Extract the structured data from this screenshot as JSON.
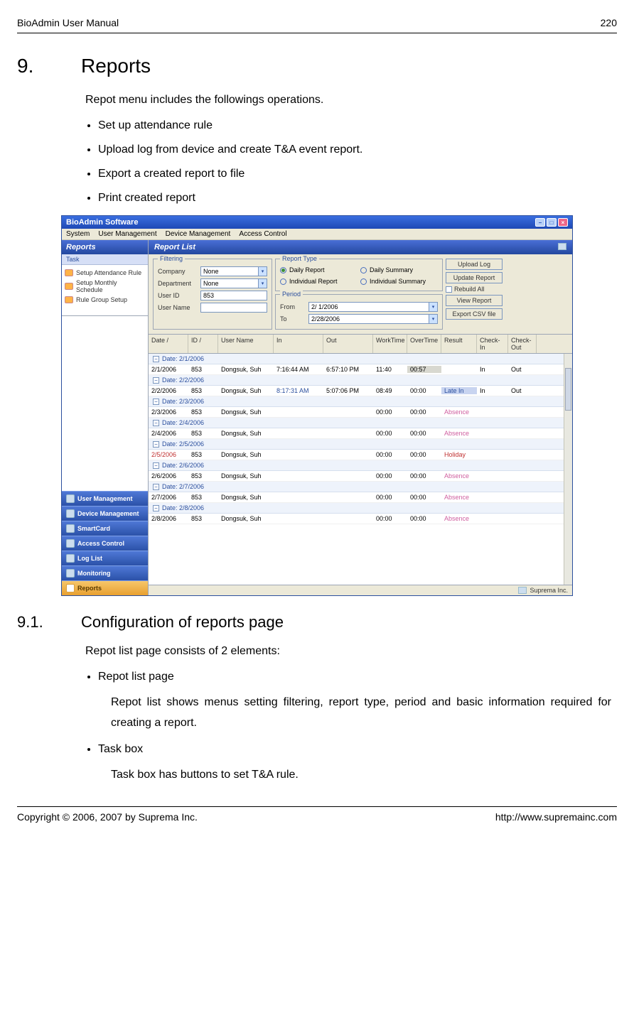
{
  "header": {
    "left": "BioAdmin User Manual",
    "right": "220"
  },
  "section": {
    "num": "9.",
    "title": "Reports"
  },
  "intro": "Repot menu includes the followings operations.",
  "bullets1": [
    "Set up attendance rule",
    "Upload log from device and create T&A event report.",
    "Export a created report to file",
    "Print created report"
  ],
  "subsection": {
    "num": "9.1.",
    "title": "Configuration of reports page"
  },
  "intro2": "Repot list page consists of 2 elements:",
  "items2": [
    {
      "title": "Repot list page",
      "desc": "Repot list shows menus setting filtering, report type, period and basic information required for creating a report."
    },
    {
      "title": "Task box",
      "desc": "Task box has buttons to set T&A rule."
    }
  ],
  "footer": {
    "left": "Copyright © 2006, 2007 by Suprema Inc.",
    "right": "http://www.supremainc.com"
  },
  "app": {
    "title": "BioAdmin Software",
    "menus": [
      "System",
      "User Management",
      "Device Management",
      "Access Control"
    ],
    "leftHeader": "Reports",
    "taskHeader": "Task",
    "tasks": [
      "Setup Attendance Rule",
      "Setup Monthly Schedule",
      "Rule Group Setup"
    ],
    "nav": [
      "User Management",
      "Device Management",
      "SmartCard",
      "Access Control",
      "Log List",
      "Monitoring",
      "Reports"
    ],
    "navActive": "Reports",
    "rightHeader": "Report List",
    "filtering": {
      "legend": "Filtering",
      "company": {
        "label": "Company",
        "value": "None"
      },
      "department": {
        "label": "Department",
        "value": "None"
      },
      "userId": {
        "label": "User ID",
        "value": "853"
      },
      "userName": {
        "label": "User Name",
        "value": ""
      }
    },
    "reportType": {
      "legend": "Report Type",
      "options": [
        "Daily Report",
        "Daily Summary",
        "Individual Report",
        "Individual Summary"
      ],
      "selected": "Daily Report"
    },
    "period": {
      "legend": "Period",
      "from": {
        "label": "From",
        "value": "2/ 1/2006"
      },
      "to": {
        "label": "To",
        "value": "2/28/2006"
      }
    },
    "buttons": {
      "upload": "Upload Log",
      "update": "Update Report",
      "rebuild": "Rebuild All",
      "view": "View Report",
      "export": "Export CSV file"
    },
    "columns": [
      "Date   /",
      "ID   /",
      "User Name",
      "In",
      "Out",
      "WorkTime",
      "OverTime",
      "Result",
      "Check-In",
      "Check-Out"
    ],
    "groups": [
      {
        "label": "Date: 2/1/2006",
        "rows": [
          {
            "date": "2/1/2006",
            "id": "853",
            "name": "Dongsuk, Suh",
            "in": "7:16:44 AM",
            "out": "6:57:10 PM",
            "wt": "11:40",
            "ot": "00:57",
            "res": "",
            "ci": "In",
            "co": "Out",
            "hlOT": true
          }
        ]
      },
      {
        "label": "Date: 2/2/2006",
        "rows": [
          {
            "date": "2/2/2006",
            "id": "853",
            "name": "Dongsuk, Suh",
            "in": "8:17:31 AM",
            "out": "5:07:06 PM",
            "wt": "08:49",
            "ot": "00:00",
            "res": "Late In",
            "ci": "In",
            "co": "Out",
            "blueIn": true,
            "hl2Res": true
          }
        ]
      },
      {
        "label": "Date: 2/3/2006",
        "rows": [
          {
            "date": "2/3/2006",
            "id": "853",
            "name": "Dongsuk, Suh",
            "in": "",
            "out": "",
            "wt": "00:00",
            "ot": "00:00",
            "res": "Absence",
            "ci": "",
            "co": "",
            "pink": true
          }
        ]
      },
      {
        "label": "Date: 2/4/2006",
        "rows": [
          {
            "date": "2/4/2006",
            "id": "853",
            "name": "Dongsuk, Suh",
            "in": "",
            "out": "",
            "wt": "00:00",
            "ot": "00:00",
            "res": "Absence",
            "ci": "",
            "co": "",
            "pink": true
          }
        ]
      },
      {
        "label": "Date: 2/5/2006",
        "rows": [
          {
            "date": "2/5/2006",
            "id": "853",
            "name": "Dongsuk, Suh",
            "in": "",
            "out": "",
            "wt": "00:00",
            "ot": "00:00",
            "res": "Holiday",
            "ci": "",
            "co": "",
            "redDate": true,
            "redRes": true
          }
        ]
      },
      {
        "label": "Date: 2/6/2006",
        "rows": [
          {
            "date": "2/6/2006",
            "id": "853",
            "name": "Dongsuk, Suh",
            "in": "",
            "out": "",
            "wt": "00:00",
            "ot": "00:00",
            "res": "Absence",
            "ci": "",
            "co": "",
            "pink": true
          }
        ]
      },
      {
        "label": "Date: 2/7/2006",
        "rows": [
          {
            "date": "2/7/2006",
            "id": "853",
            "name": "Dongsuk, Suh",
            "in": "",
            "out": "",
            "wt": "00:00",
            "ot": "00:00",
            "res": "Absence",
            "ci": "",
            "co": "",
            "pink": true
          }
        ]
      },
      {
        "label": "Date: 2/8/2006",
        "rows": [
          {
            "date": "2/8/2006",
            "id": "853",
            "name": "Dongsuk, Suh",
            "in": "",
            "out": "",
            "wt": "00:00",
            "ot": "00:00",
            "res": "Absence",
            "ci": "",
            "co": "",
            "pink": true
          }
        ]
      }
    ],
    "status": "Suprema Inc."
  }
}
